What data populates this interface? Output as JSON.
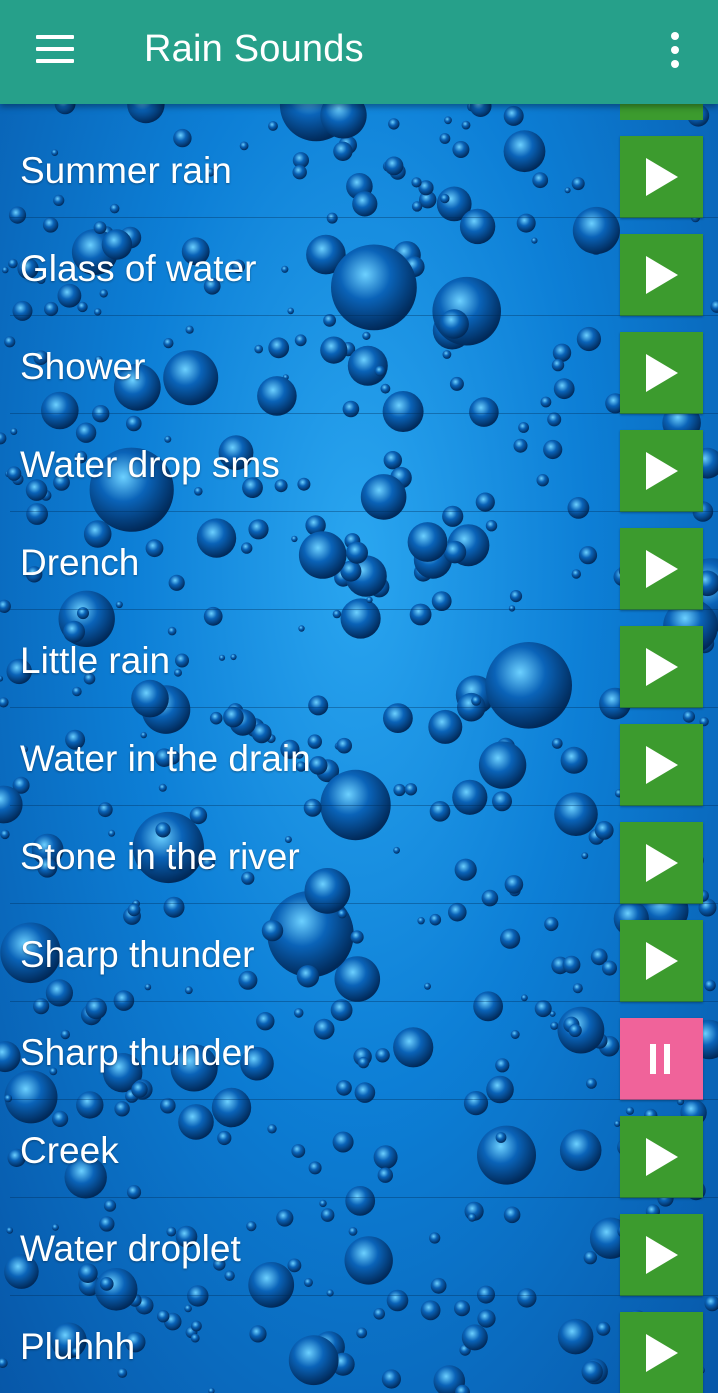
{
  "appbar": {
    "title": "Rain Sounds",
    "menu_icon": "hamburger-menu-icon",
    "more_icon": "more-vertical-icon",
    "color": "#26a08a"
  },
  "colors": {
    "play_button": "#3c9b2e",
    "pause_button": "#f0639a",
    "background": "#0d7fd6"
  },
  "sounds": [
    {
      "label": "Summer rain",
      "state": "play"
    },
    {
      "label": "Glass of water",
      "state": "play"
    },
    {
      "label": "Shower",
      "state": "play"
    },
    {
      "label": "Water drop sms",
      "state": "play"
    },
    {
      "label": "Drench",
      "state": "play"
    },
    {
      "label": "Little rain",
      "state": "play"
    },
    {
      "label": "Water in the drain",
      "state": "play"
    },
    {
      "label": "Stone in the river",
      "state": "play"
    },
    {
      "label": "Sharp thunder",
      "state": "play"
    },
    {
      "label": "Sharp thunder",
      "state": "pause"
    },
    {
      "label": "Creek",
      "state": "play"
    },
    {
      "label": "Water droplet",
      "state": "play"
    },
    {
      "label": "Pluhhh",
      "state": "play"
    }
  ]
}
